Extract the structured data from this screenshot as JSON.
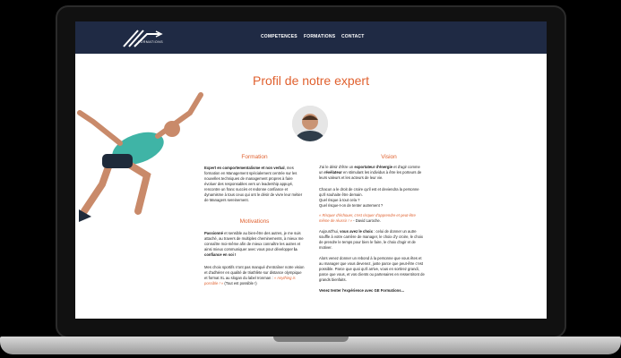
{
  "nav": {
    "logo_text": "FORMATIONS",
    "items": [
      "COMPETENCES",
      "FORMATIONS",
      "CONTACT"
    ]
  },
  "title": "Profil de notre expert",
  "formation": {
    "heading": "Formation",
    "lead_bold": "Expert en comportementalisme et non verbal",
    "text": ", mes formation en Management spécialement centrée sur les nouvelles techniques de management propres à faire évoluer des responsables vers un leadership appuyé, rencontre un franc succès et redonne confiance et dynamisme à tous ceux qui ont le désir de vivre leur métier de Managers sereinement."
  },
  "motivations": {
    "heading": "Motivations",
    "p1_bold": "Passionné",
    "p1_text": " et sensible au bien-être des autres, je me suis attaché, au travers de multiples cheminements, à mieux me connaître moi-même afin de mieux connaître les autres et ainsi mieux communiquer avec vous pour développer ",
    "p1_bold2": "la confiance en soi !",
    "p2_text": "Mes choix sportifs n'ont pas manqué d'entraîner notre vision et d'adhérer en qualité de triathlète sur distance olympique et format XL au slogan du label Ironman : ",
    "p2_quote": "« Anything is possible ! »",
    "p2_end": " (Tout est possible !)"
  },
  "vision": {
    "heading": "Vision",
    "p1_text": "J'ai le désir d'être un ",
    "p1_bold": "exportateur d'énergie",
    "p1_text2": " et d'agir comme un ",
    "p1_bold2": "révélateur",
    "p1_text3": " en stimulant les individus à être les porteurs de leurs valeurs et les acteurs de leur vie.",
    "p2": "Chacun a le droit de croire qu'il est et deviendra la personne qu'il souhaite être demain.",
    "p3": "Quel risque à tout cela ?",
    "p4": "Quel risque-t-on de tenter autrement ?",
    "quote": "« Risquer d'échouer, c'est risquer d'apprendre et peut-être même de réussir ! »",
    "quote_author": " - David Laroche.",
    "p5_text": "Aujourd'hui, ",
    "p5_bold": "vous avez le choix",
    "p5_text2": " : celui de donner un autre souffle à votre carrière de manager, le choix d'y croire, le choix de prendre le temps pour bien le faire, le choix d'agir et de motiver.",
    "p6": "Alors venez donner un rebond à la personne que vous êtes et au manager que vous devenez, juste parce que peut-être c'est possible. Parce que quoi qu'il arrive, vous en sortirez grandi, parce que vous, et vos clients ou partenaires en ressentiront de grands bienfaits.",
    "p6_bold": "Venez tenter l'expérience avec GE Formations..."
  }
}
